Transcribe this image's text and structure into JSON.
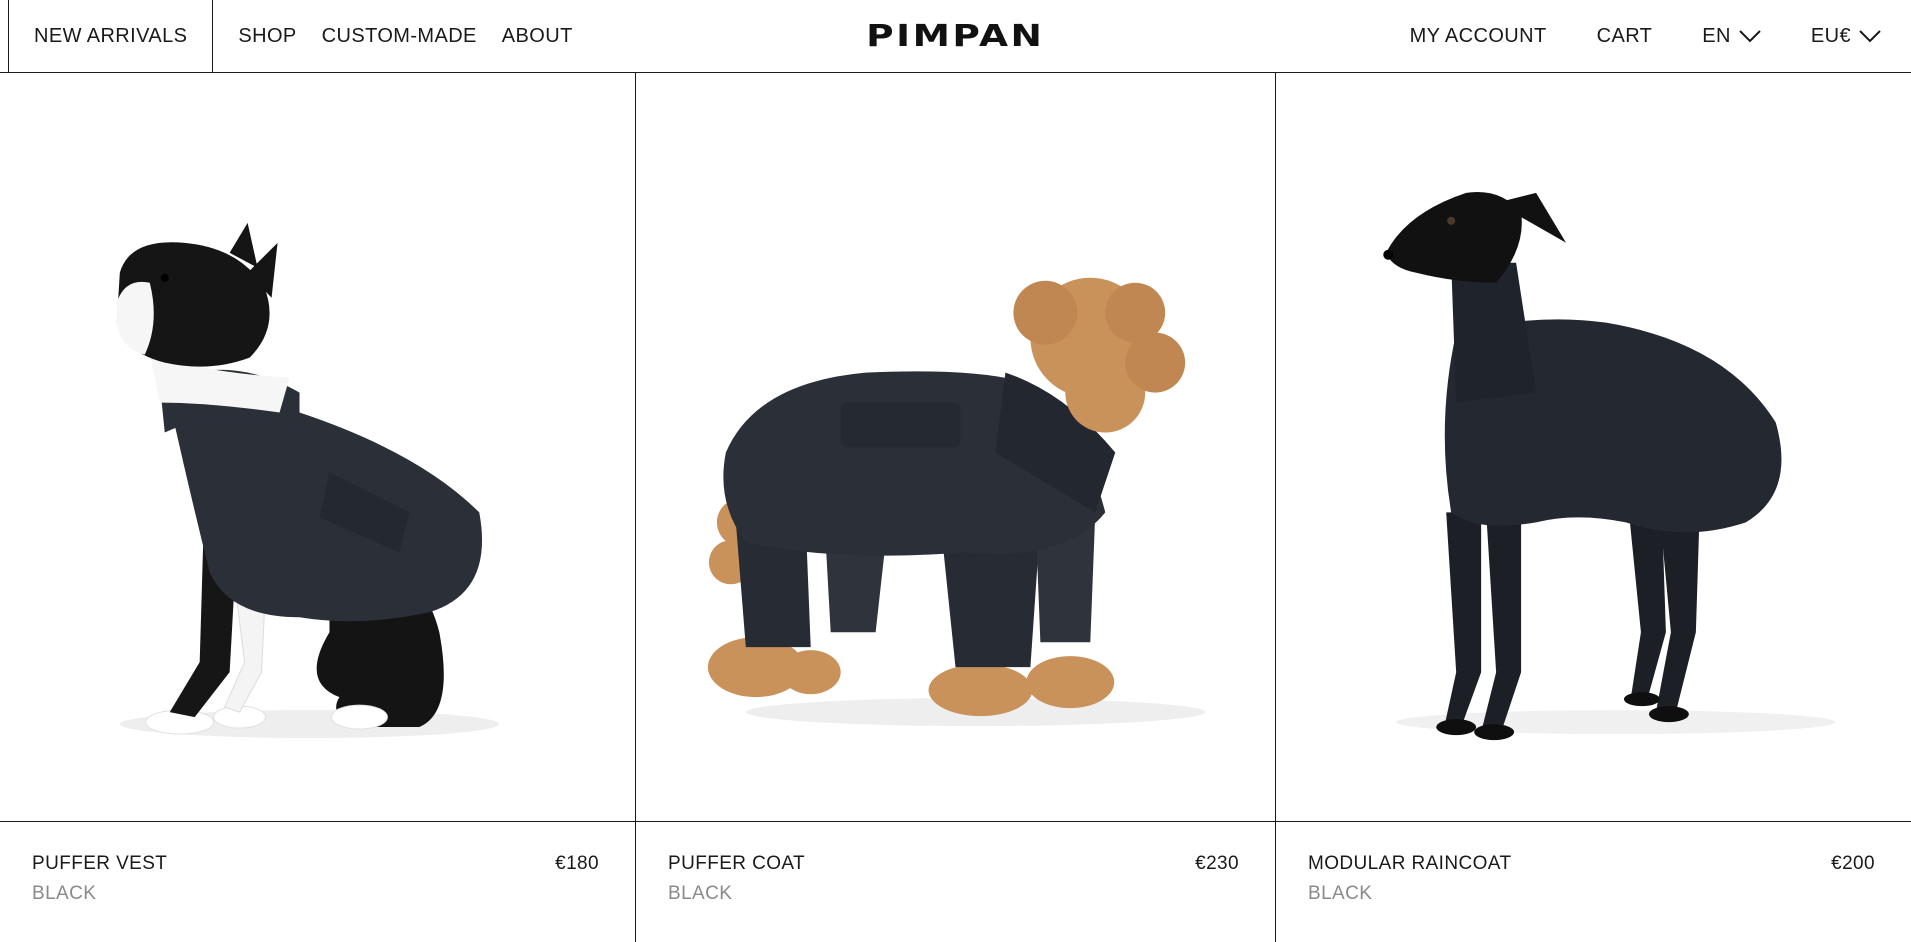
{
  "header": {
    "nav_left": {
      "new_arrivals": "NEW ARRIVALS",
      "shop": "SHOP",
      "custom_made": "CUSTOM-MADE",
      "about": "ABOUT"
    },
    "logo": "PIMPAN",
    "nav_right": {
      "my_account": "MY ACCOUNT",
      "cart": "CART",
      "language": "EN",
      "currency": "EU€"
    }
  },
  "products": [
    {
      "name": "PUFFER VEST",
      "color": "BLACK",
      "price": "€180",
      "image_icon": "dog-puffer-vest-image"
    },
    {
      "name": "PUFFER COAT",
      "color": "BLACK",
      "price": "€230",
      "image_icon": "dog-puffer-coat-image"
    },
    {
      "name": "MODULAR RAINCOAT",
      "color": "BLACK",
      "price": "€200",
      "image_icon": "dog-modular-raincoat-image"
    }
  ],
  "colors": {
    "text": "#1a1a1a",
    "muted_text": "#8a8a8a",
    "garment": "#2b2f38",
    "border": "#1a1a1a",
    "background": "#ffffff"
  }
}
